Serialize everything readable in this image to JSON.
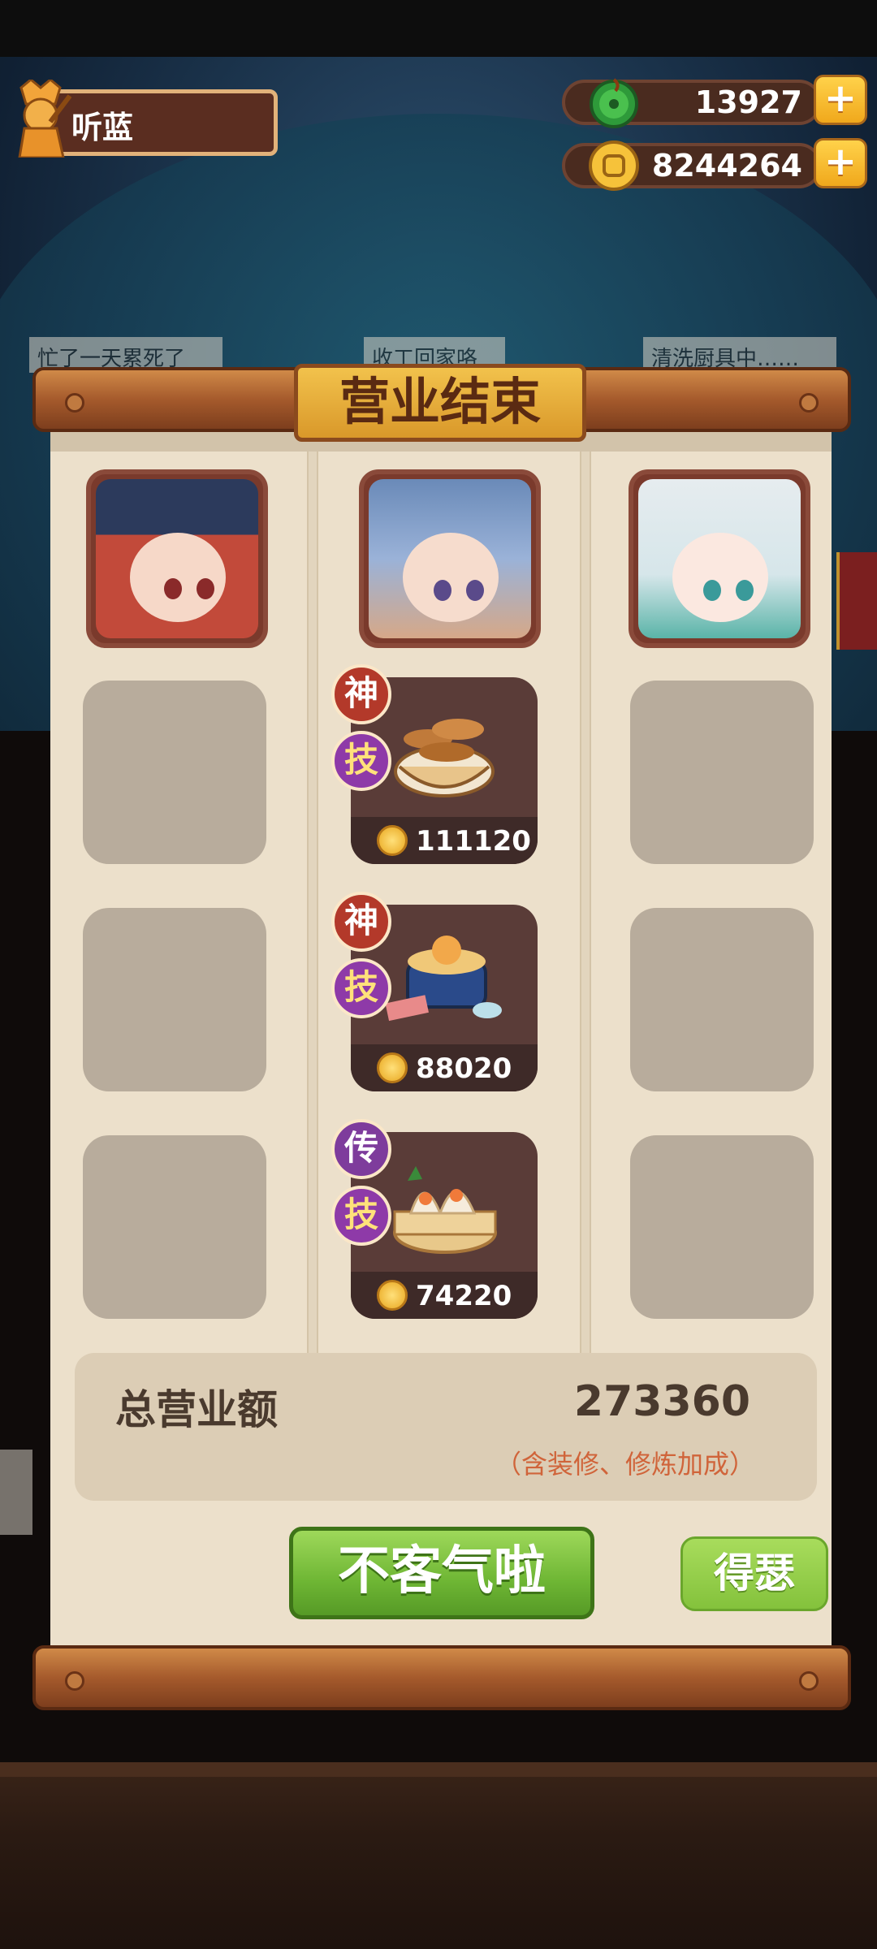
{
  "background_signs": [
    "忙了一天累死了",
    "收工回家咯",
    "清洗厨具中……"
  ],
  "player": {
    "name": "听蓝"
  },
  "resources": {
    "jade": {
      "value": "13927",
      "icon": "jade-coin-icon"
    },
    "coin": {
      "value": "8244264",
      "icon": "gold-coin-icon"
    },
    "plus_label": "+"
  },
  "panel": {
    "title": "营业结束",
    "dishes": [
      {
        "badge": "神",
        "tag": "技",
        "price": "111120",
        "icon": "mushroom-stew-icon"
      },
      {
        "badge": "神",
        "tag": "技",
        "price": "88020",
        "icon": "banquet-hotpot-icon"
      },
      {
        "badge": "传",
        "tag": "技",
        "price": "74220",
        "icon": "steamed-dumplings-icon"
      }
    ],
    "total": {
      "label": "总营业额",
      "value": "273360",
      "note": "（含装修、修炼加成）"
    },
    "buttons": {
      "main": "不客气啦",
      "side": "得瑟"
    }
  },
  "colors": {
    "accent_green": "#6eb634",
    "title_gold": "#e7b03a",
    "note_orange": "#d0643a"
  }
}
